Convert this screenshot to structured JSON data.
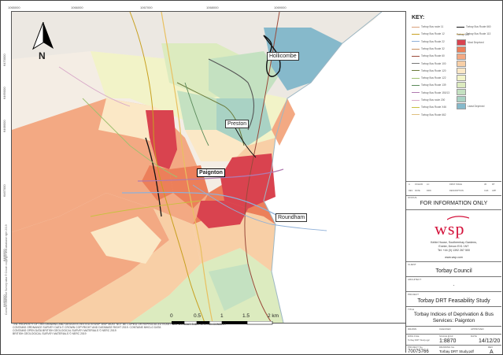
{
  "grid": {
    "top_labels": [
      "1065000",
      "1066000",
      "1067000",
      "1068000",
      "1069000"
    ],
    "left_labels": [
      "6470000",
      "6469000",
      "6468000",
      "6467000",
      "6466000",
      "6465000"
    ]
  },
  "places": {
    "hollicombe": "Hollicombe",
    "preston": "Preston",
    "paignton": "Paignton",
    "roundham": "Roundham"
  },
  "north_label": "N",
  "scale": {
    "ticks": [
      "0",
      "0.5",
      "1",
      "1.5",
      "2 km"
    ]
  },
  "notes": [
    "THE PROPERTY OF THIS DRAWING AND DESIGN IS VESTED IN WSP. WSP MUST NOT BE COPIED OR REPRODUCED IN ANY WAY WITHOUT THEIR WRITTEN CONSENT",
    "CONTAINS ORDNANCE SURVEY DATA © CROWN COPYRIGHT AND DATABASE RIGHT 2019. CONTAINS MHCLG DATA",
    "CONTAINS OPEN DATA BRITISH GEOLOGICAL SURVEY MATERIALS © NERC 2019",
    "BRITISH GEOLOGICAL SURVEY MATERIALS © NERC 2019"
  ],
  "key": {
    "title": "KEY:",
    "routes": [
      {
        "label": "Torbay Bus route 11",
        "color": "#d9a07a"
      },
      {
        "label": "Torbay Bus Route 12",
        "color": "#c8a020"
      },
      {
        "label": "Torbay Bus Route 22",
        "color": "#8fb0d8"
      },
      {
        "label": "Torbay Bus Route 32",
        "color": "#c89060"
      },
      {
        "label": "Torbay Bus Route 60",
        "color": "#9a4a3a"
      },
      {
        "label": "Torbay Bus Route 100",
        "color": "#777777"
      },
      {
        "label": "Torbay Bus Route 120",
        "color": "#6a7a3a"
      },
      {
        "label": "Torbay Bus Route 122",
        "color": "#a0c070"
      },
      {
        "label": "Torbay Bus Route 139",
        "color": "#5a8a5a"
      },
      {
        "label": "Torbay Bus Route 150/13",
        "color": "#b07ab0"
      },
      {
        "label": "Torbay Bus route 200",
        "color": "#d8a8c8"
      },
      {
        "label": "Torbay Bus Route X46",
        "color": "#c8c040"
      },
      {
        "label": "Torbay Bus Route 662",
        "color": "#e0c080"
      }
    ],
    "extra_routes": [
      {
        "label": "Torbay Bus Route 660",
        "color": "#111111"
      },
      {
        "label": "Torbay Bus Route 113",
        "color": "#e8c060"
      }
    ],
    "imd_heading": "Torbay IMD",
    "imd": [
      {
        "label": "Most Deprived",
        "color": "#d9434f"
      },
      {
        "label": "",
        "color": "#ec7f5a"
      },
      {
        "label": "",
        "color": "#f3a983"
      },
      {
        "label": "",
        "color": "#f8cfa6"
      },
      {
        "label": "",
        "color": "#fbe8c6"
      },
      {
        "label": "",
        "color": "#f2f3c8"
      },
      {
        "label": "",
        "color": "#dcebbf"
      },
      {
        "label": "",
        "color": "#c4e1c1"
      },
      {
        "label": "",
        "color": "#a9d2c4"
      },
      {
        "label": "Least Deprived",
        "color": "#86b9cb"
      }
    ]
  },
  "revision": {
    "row": [
      "A",
      "15/12/20",
      "LC",
      "FIRST ISSUE",
      "JD",
      "RT"
    ],
    "headers": [
      "REV",
      "DATE",
      "DRN",
      "DESCRIPTION",
      "CHK",
      "APP"
    ]
  },
  "status_label": "STATUS",
  "status": "FOR INFORMATION ONLY",
  "company": {
    "logo": "wsp",
    "address_lines": [
      "Keble House, Southernhay Gardens,",
      "Exeter, Devon EX1 1NT",
      "Tel: +44 (0) 1392 267 500"
    ],
    "web": "www.wsp.com"
  },
  "client_label": "CLIENT",
  "client": "Torbay Council",
  "architect_label": "ARCHITECT",
  "architect": "-",
  "project_label": "PROJECT",
  "project": "Torbay DRT Feasability Study",
  "title_label": "TITLE",
  "title_lines": [
    "Torbay Indices of Deprivation & Bus",
    "Services: Paignton"
  ],
  "grid_fields": [
    {
      "label": "DRAWN",
      "value": ""
    },
    {
      "label": "CHECKED",
      "value": ""
    },
    {
      "label": "APPROVED",
      "value": ""
    }
  ],
  "file_info": [
    {
      "label": "DWG FILE",
      "value": "Torbay DRT Study.qgz"
    },
    {
      "label": "SCALE @A3",
      "value": "1:8870"
    },
    {
      "label": "DATE",
      "value": "14/12/20"
    }
  ],
  "numbers": [
    {
      "label": "PROJECT No.",
      "value": "70075766"
    },
    {
      "label": "DRAWING No.",
      "value": "Torbay DRT Study.pdf"
    },
    {
      "label": "REV",
      "value": "A"
    }
  ],
  "side_note": "Contains Ordnance Survey data © Crown copyright and database right 2019"
}
